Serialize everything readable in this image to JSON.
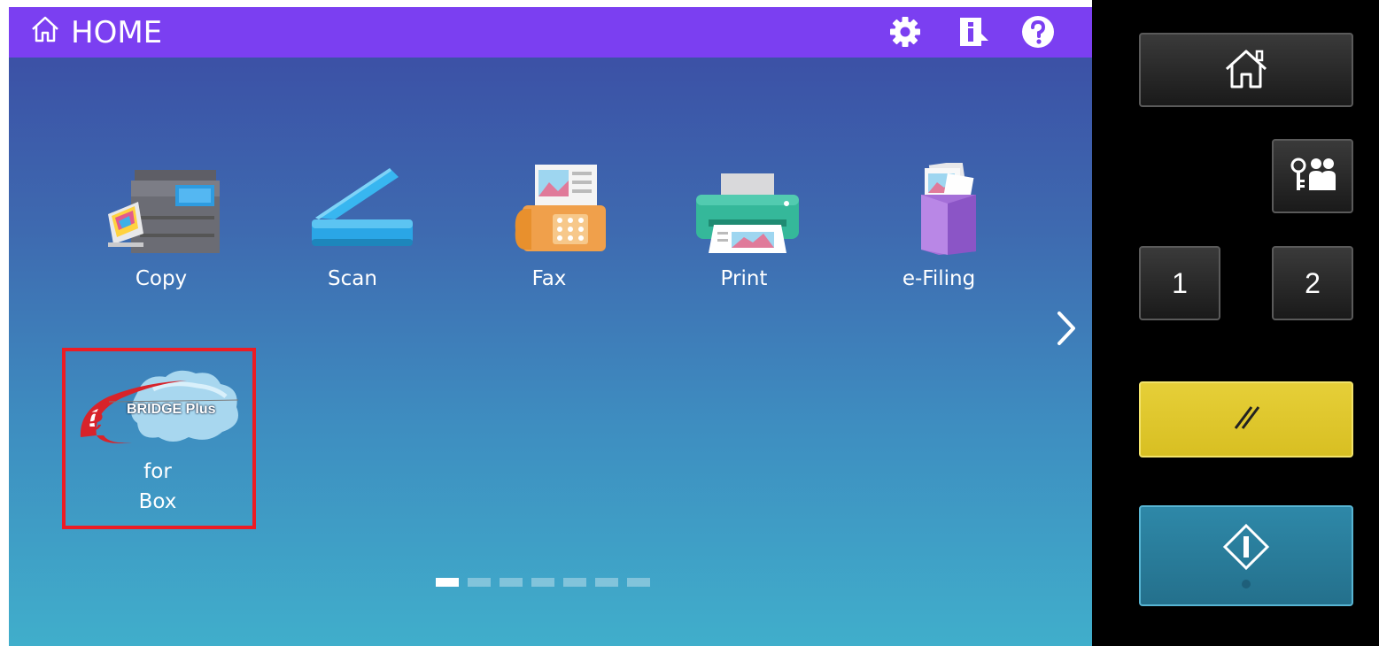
{
  "header": {
    "title": "HOME",
    "icons": [
      "home-icon",
      "settings-gear-icon",
      "info-icon",
      "help-icon"
    ]
  },
  "apps": [
    {
      "label": "Copy",
      "icon": "copier-icon"
    },
    {
      "label": "Scan",
      "icon": "scanner-icon"
    },
    {
      "label": "Fax",
      "icon": "fax-icon"
    },
    {
      "label": "Print",
      "icon": "printer-icon"
    },
    {
      "label": "e-Filing",
      "icon": "efiling-box-icon"
    }
  ],
  "box_app": {
    "logo_text": "BRIDGE Plus",
    "logo_prefix": "e",
    "label_line1": "for",
    "label_line2": "Box"
  },
  "pager": {
    "pages": 7,
    "current": 1
  },
  "side_panel": {
    "access_key_1": "1",
    "access_key_2": "2",
    "buttons": [
      "home-icon",
      "user-auth-icon",
      "reset-icon",
      "start-icon"
    ]
  },
  "colors": {
    "header_bar": "#7b3ff1",
    "highlight_border": "#ec1c24",
    "reset_button": "#e0c92e",
    "start_button": "#2e7f9f",
    "side_panel": "#000000"
  }
}
